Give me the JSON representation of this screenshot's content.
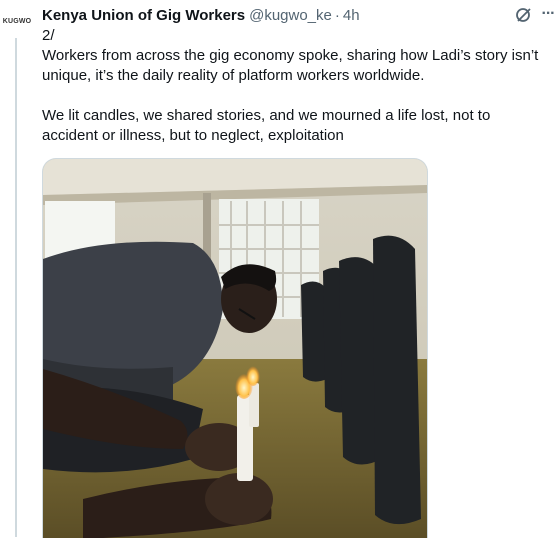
{
  "tweet": {
    "author_name": "Kenya Union of Gig Workers",
    "handle": "@kugwo_ke",
    "separator": "·",
    "time": "4h",
    "avatar_text": "KUGWO",
    "text_lines": [
      "2/",
      "Workers from across the gig economy spoke, sharing how Ladi’s story isn’t",
      "unique, it’s the daily reality of platform workers worldwide."
    ],
    "text_paragraph2": [
      "We lit candles, we shared stories, and we mourned a life lost, not to",
      "accident or illness, but to neglect, exploitation"
    ],
    "media_description": "photo",
    "icons": [
      "grok-icon",
      "more-icon"
    ]
  }
}
